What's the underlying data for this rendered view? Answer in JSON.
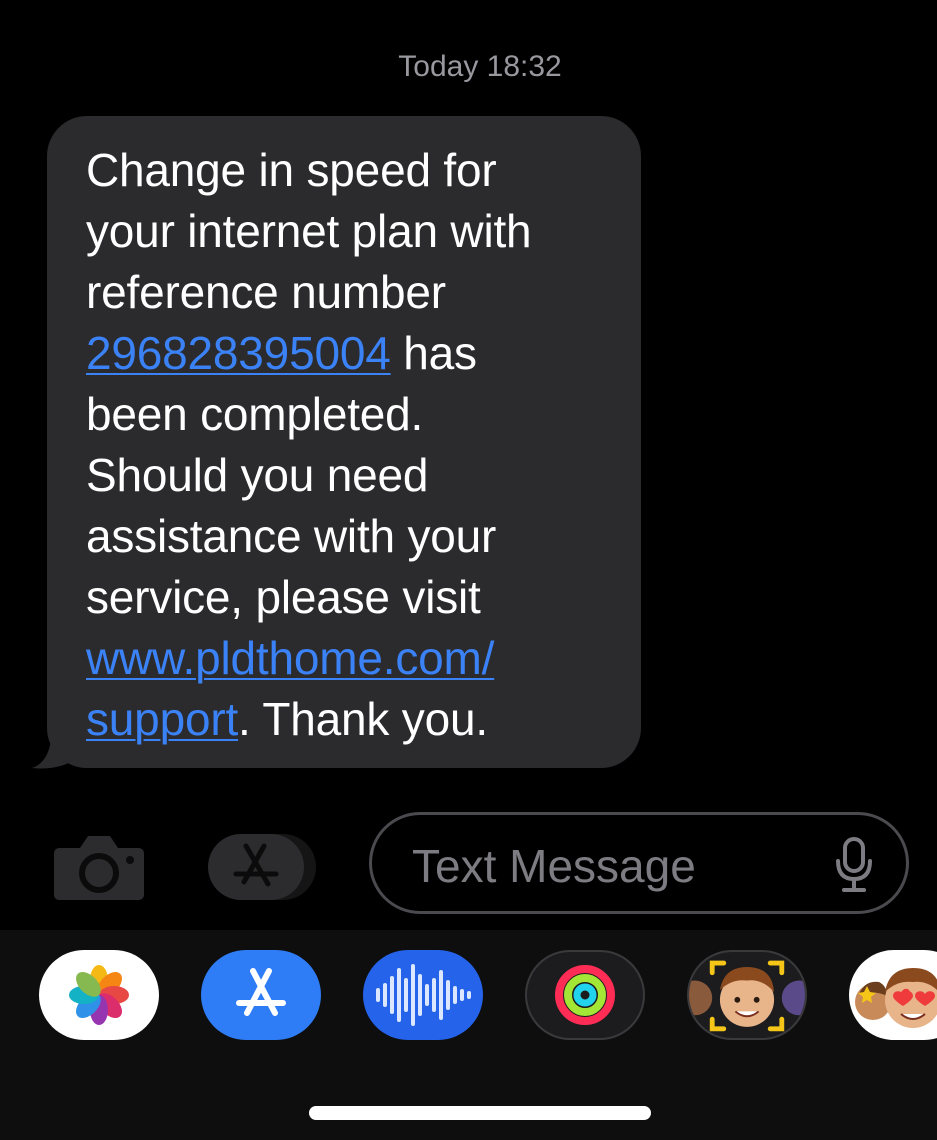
{
  "header": {
    "timestamp": "Today 18:32"
  },
  "message": {
    "line1": "Change in speed for",
    "line2": "your internet plan with",
    "line3": "reference number",
    "reference_number": "296828395004",
    "after_ref": " has",
    "line5": "been completed.",
    "line6": "Should you need",
    "line7": "assistance with your",
    "line8": "service, please visit",
    "url_part1": "www.pldthome.com/",
    "url_part2": "support",
    "closing": ". Thank you."
  },
  "compose": {
    "placeholder": "Text Message",
    "camera_icon": "camera-icon",
    "apps_icon": "app-store-icon",
    "mic_icon": "microphone-icon"
  },
  "app_tray": [
    {
      "name": "photos-app",
      "icon": "photos-flower-icon",
      "color": "#ffffff"
    },
    {
      "name": "app-store-app",
      "icon": "app-store-icon",
      "color": "#2f7df6"
    },
    {
      "name": "audio-message-app",
      "icon": "waveform-icon",
      "color": "#2563eb"
    },
    {
      "name": "activity-app",
      "icon": "activity-rings-icon",
      "color": "#1c1c1e"
    },
    {
      "name": "memoji-app",
      "icon": "memoji-face-icon",
      "color": "#1c1c1e"
    },
    {
      "name": "memoji-stickers-app",
      "icon": "memoji-heart-eyes-icon",
      "color": "#ffffff"
    }
  ],
  "colors": {
    "background": "#000000",
    "bubble": "#2b2b2d",
    "link": "#3b82f6",
    "timestamp": "#98989f",
    "tray": "#0e0e0e"
  }
}
